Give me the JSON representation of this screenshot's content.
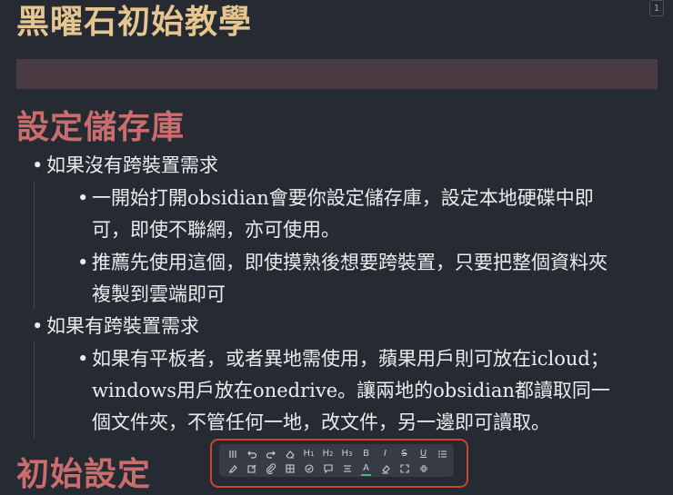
{
  "page_number": "1",
  "doc_title": "黑曜石初始教學",
  "sections": [
    {
      "heading": "設定儲存庫",
      "items": [
        {
          "text": "如果沒有跨裝置需求",
          "children": [
            {
              "lines": [
                "一開始打開obsidian會要你設定儲存庫，設定本地硬碟中即",
                "可，即使不聯網，亦可使用。"
              ]
            },
            {
              "lines": [
                "推薦先使用這個，即使摸熟後想要跨裝置，只要把整個資料夾",
                "複製到雲端即可"
              ]
            }
          ]
        },
        {
          "text": "如果有跨裝置需求",
          "children": [
            {
              "lines": [
                "如果有平板者，或者異地需使用，蘋果用戶則可放在icloud；",
                "windows用戶放在onedrive。讓兩地的obsidian都讀取同一",
                "個文件夾，不管任何一地，改文件，另一邊即可讀取。"
              ]
            }
          ]
        }
      ]
    },
    {
      "heading": "初始設定"
    }
  ],
  "toolbar": {
    "row1": [
      "grip-icon",
      "undo-icon",
      "redo-icon",
      "eraser-icon",
      "h1-icon",
      "h2-icon",
      "h3-icon",
      "bold-icon",
      "italic-icon",
      "strikethrough-icon",
      "underline-icon",
      "bullet-list-icon"
    ],
    "row2": [
      "highlighter-icon",
      "edit-icon",
      "attachment-icon",
      "table-icon",
      "checkbox-icon",
      "comment-icon",
      "align-icon",
      "font-color-icon",
      "fill-color-icon",
      "fullscreen-icon",
      "exit-fullscreen-icon"
    ],
    "labels": {
      "h1": "H",
      "h2": "H",
      "h3": "H",
      "h1_sub": "1",
      "h2_sub": "2",
      "h3_sub": "3",
      "bold": "B",
      "italic": "I",
      "underline": "U",
      "strike": "S",
      "font_color": "A"
    },
    "accent_colors": {
      "outline": "#d0442e",
      "font_color_bar": "#3cc06a"
    }
  },
  "colors": {
    "background": "#262a33",
    "title": "#e6c58f",
    "heading": "#c96d6d",
    "banner": "#4a3b42"
  }
}
